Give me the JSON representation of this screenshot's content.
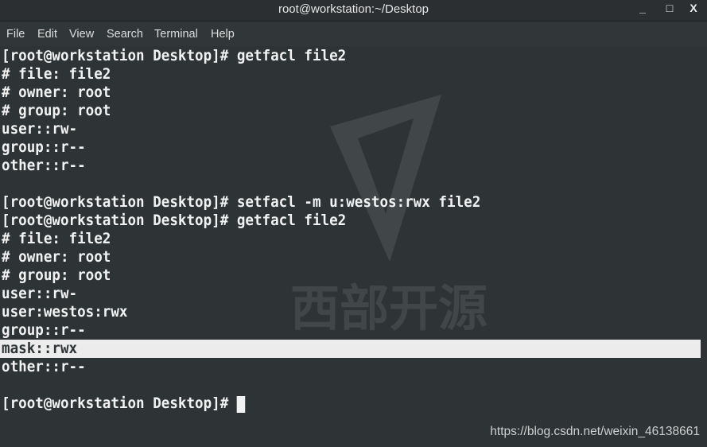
{
  "window": {
    "title": "root@workstation:~/Desktop",
    "minimize": "_",
    "maximize": "□",
    "close": "X"
  },
  "menu": [
    "File",
    "Edit",
    "View",
    "Search",
    "Terminal",
    "Help"
  ],
  "terminal": {
    "lines": [
      "[root@workstation Desktop]# getfacl file2",
      "# file: file2",
      "# owner: root",
      "# group: root",
      "user::rw-",
      "group::r--",
      "other::r--",
      "",
      "[root@workstation Desktop]# setfacl -m u:westos:rwx file2",
      "[root@workstation Desktop]# getfacl file2",
      "# file: file2",
      "# owner: root",
      "# group: root",
      "user::rw-",
      "user:westos:rwx",
      "group::r--",
      "mask::rwx",
      "other::r--",
      "",
      "[root@workstation Desktop]# "
    ],
    "highlighted_line": 16
  },
  "watermark": {
    "text": "西部开源"
  },
  "source_url": "https://blog.csdn.net/weixin_46138661"
}
